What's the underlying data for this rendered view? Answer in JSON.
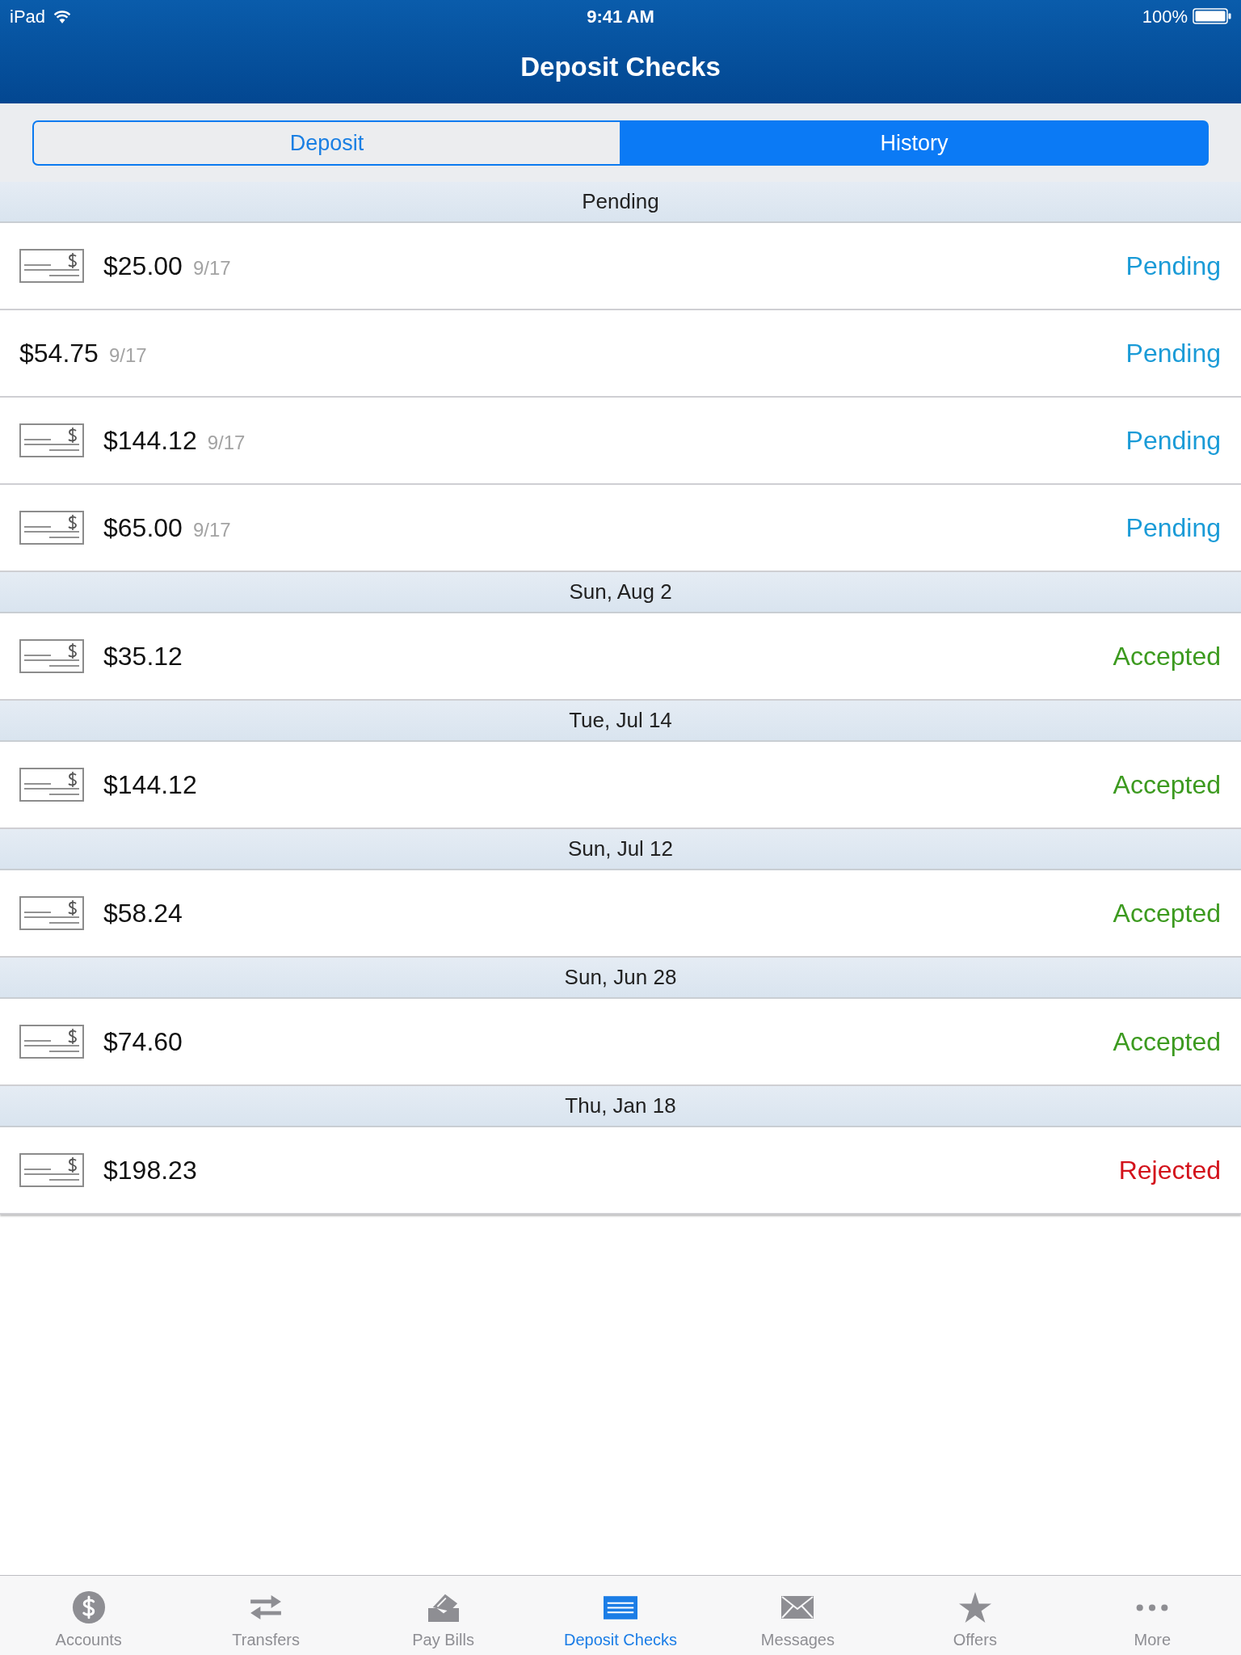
{
  "status_bar": {
    "carrier": "iPad",
    "time": "9:41 AM",
    "battery": "100%"
  },
  "nav_bar": {
    "title": "Deposit Checks"
  },
  "segments": [
    {
      "label": "Deposit",
      "selected": false
    },
    {
      "label": "History",
      "selected": true
    }
  ],
  "sections": [
    {
      "title": "Pending",
      "rows": [
        {
          "has_image": true,
          "amount": "$25.00",
          "date": "9/17",
          "status": "Pending",
          "color": "#1a9bd7"
        },
        {
          "has_image": false,
          "amount": "$54.75",
          "date": "9/17",
          "status": "Pending",
          "color": "#1a9bd7"
        },
        {
          "has_image": true,
          "amount": "$144.12",
          "date": "9/17",
          "status": "Pending",
          "color": "#1a9bd7"
        },
        {
          "has_image": true,
          "amount": "$65.00",
          "date": "9/17",
          "status": "Pending",
          "color": "#1a9bd7"
        }
      ]
    },
    {
      "title": "Sun, Aug 2",
      "rows": [
        {
          "has_image": true,
          "amount": "$35.12",
          "status": "Accepted",
          "color": "#3c9a1f"
        }
      ]
    },
    {
      "title": "Tue, Jul 14",
      "rows": [
        {
          "has_image": true,
          "amount": "$144.12",
          "status": "Accepted",
          "color": "#3c9a1f"
        }
      ]
    },
    {
      "title": "Sun, Jul 12",
      "rows": [
        {
          "has_image": true,
          "amount": "$58.24",
          "status": "Accepted",
          "color": "#3c9a1f"
        }
      ]
    },
    {
      "title": "Sun, Jun 28",
      "rows": [
        {
          "has_image": true,
          "amount": "$74.60",
          "status": "Accepted",
          "color": "#3c9a1f"
        }
      ]
    },
    {
      "title": "Thu, Jan 18",
      "rows": [
        {
          "has_image": true,
          "amount": "$198.23",
          "status": "Rejected",
          "color": "#d3121b"
        }
      ]
    }
  ],
  "tab_bar": [
    {
      "kind": "accounts",
      "label": "Accounts",
      "selected": false
    },
    {
      "kind": "transfers",
      "label": "Transfers",
      "selected": false
    },
    {
      "kind": "paybills",
      "label": "Pay Bills",
      "selected": false
    },
    {
      "kind": "deposit",
      "label": "Deposit Checks",
      "selected": true
    },
    {
      "kind": "messages",
      "label": "Messages",
      "selected": false
    },
    {
      "kind": "offers",
      "label": "Offers",
      "selected": false
    },
    {
      "kind": "more",
      "label": "More",
      "selected": false
    }
  ]
}
